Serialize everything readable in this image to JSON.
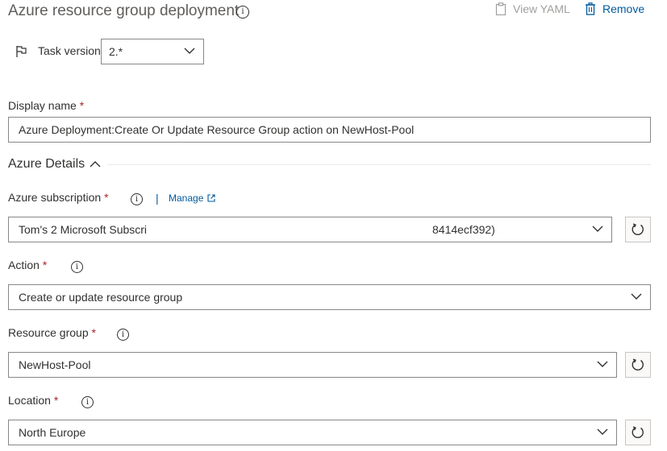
{
  "header": {
    "title": "Azure resource group deployment",
    "view_yaml": "View YAML",
    "remove": "Remove"
  },
  "task_version": {
    "label": "Task version",
    "value": "2.*"
  },
  "display_name": {
    "label": "Display name",
    "required": "*",
    "value": "Azure Deployment:Create Or Update Resource Group action on NewHost-Pool"
  },
  "section": {
    "title": "Azure Details"
  },
  "subscription": {
    "label": "Azure subscription",
    "required": "*",
    "manage": "Manage",
    "separator": "|",
    "value_left": "Tom's 2 Microsoft Subscri",
    "value_right": "8414ecf392)"
  },
  "action": {
    "label": "Action",
    "required": "*",
    "value": "Create or update resource group"
  },
  "resource_group": {
    "label": "Resource group",
    "required": "*",
    "value": "NewHost-Pool"
  },
  "location": {
    "label": "Location",
    "required": "*",
    "value": "North Europe"
  },
  "icons": {
    "info": "info-icon",
    "clipboard": "clipboard-icon",
    "trash": "trash-icon",
    "flag": "flag-icon",
    "chevron_down": "chevron-down-icon",
    "chevron_up": "chevron-up-icon",
    "external_link": "external-link-icon",
    "refresh": "refresh-icon"
  },
  "colors": {
    "link": "#005a9e",
    "required": "#a4262c",
    "border": "#8a8886",
    "muted": "#a19f9d"
  }
}
